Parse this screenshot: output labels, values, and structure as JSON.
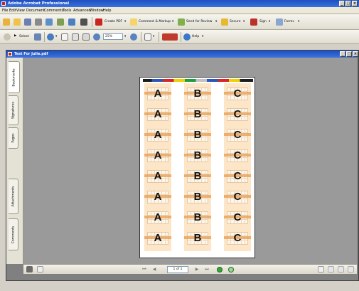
{
  "app": {
    "title": "Adobe Acrobat Professional"
  },
  "menu": [
    "File",
    "Edit",
    "View",
    "Document",
    "Comments",
    "Tools",
    "Advanced",
    "Window",
    "Help"
  ],
  "toolbar1": {
    "create_pdf": "Create PDF",
    "comment_markup": "Comment & Markup",
    "send_for_review": "Send for Review",
    "secure": "Secure",
    "sign": "Sign",
    "forms": "Forms"
  },
  "toolbar2": {
    "select": "Select",
    "zoom": "25%",
    "help": "Help"
  },
  "document": {
    "title": "Test For Julie.pdf",
    "columns": [
      "A",
      "B",
      "C"
    ],
    "rows": 8
  },
  "sidebar": {
    "tabs": [
      "Bookmarks",
      "Signatures",
      "Pages",
      "Attachments",
      "Comments"
    ]
  },
  "navigation": {
    "page_indicator": "1 of 1"
  },
  "colors": {
    "titlebar": "#1e4fbf",
    "stripe": "#fde6c8",
    "accent": "#e8a055",
    "go_button": "#37a638"
  }
}
